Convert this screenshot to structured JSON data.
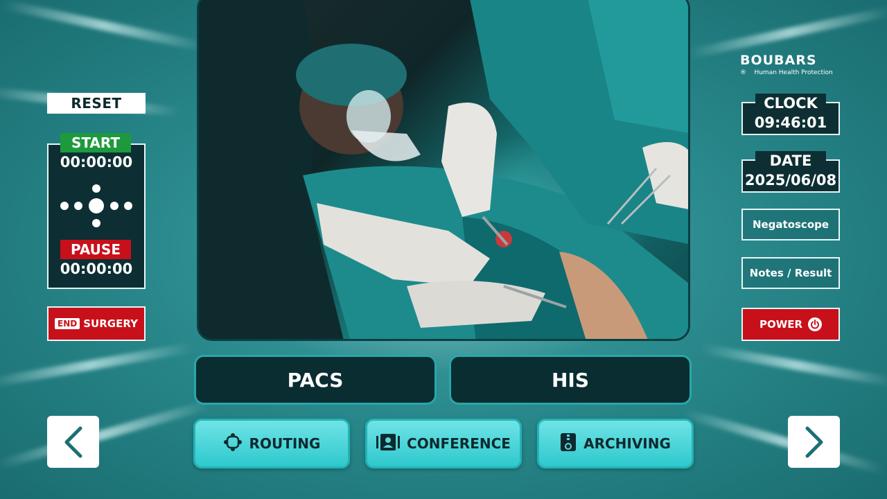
{
  "left": {
    "reset_label": "RESET",
    "start_label": "START",
    "start_time": "00:00:00",
    "pause_label": "PAUSE",
    "pause_time": "00:00:00",
    "end_tag": "END",
    "end_label": "SURGERY"
  },
  "brand": {
    "name": "BOUBARS",
    "registered": "®",
    "tagline": "Human Health Protection"
  },
  "right": {
    "clock_label": "CLOCK",
    "clock_value": "09:46:01",
    "date_label": "DATE",
    "date_value": "2025/06/08",
    "negatoscope_label": "Negatoscope",
    "notes_label": "Notes / Result",
    "power_label": "POWER"
  },
  "main": {
    "pacs_label": "PACS",
    "his_label": "HIS",
    "routing_label": "ROUTING",
    "conference_label": "CONFERENCE",
    "archiving_label": "ARCHIVING"
  },
  "colors": {
    "background": "#2b8a8e",
    "dark_panel": "#0d2f33",
    "start_green": "#1c9a3d",
    "alert_red": "#c8101a",
    "cyan_button": "#4fd6da"
  },
  "icons": {
    "routing": "routing-icon",
    "conference": "conference-icon",
    "archiving": "archive-icon",
    "power": "power-icon",
    "prev": "chevron-left-icon",
    "next": "chevron-right-icon"
  }
}
